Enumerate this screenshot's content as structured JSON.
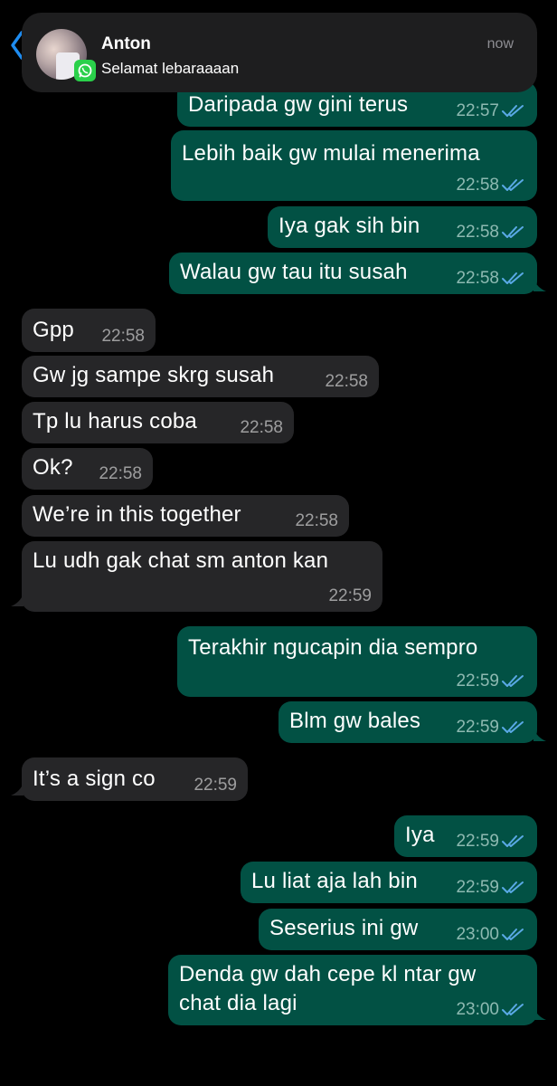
{
  "notification": {
    "sender": "Anton",
    "preview": "Selamat lebaraaaan",
    "time": "now"
  },
  "messages": [
    {
      "text": "Daripada gw gini terus",
      "time": "22:57"
    },
    {
      "text": "Lebih baik gw mulai menerima",
      "time": "22:58"
    },
    {
      "text": "Iya gak sih bin",
      "time": "22:58"
    },
    {
      "text": "Walau gw tau itu susah",
      "time": "22:58"
    },
    {
      "text": "Gpp",
      "time": "22:58"
    },
    {
      "text": "Gw jg sampe skrg susah",
      "time": "22:58"
    },
    {
      "text": "Tp lu harus coba",
      "time": "22:58"
    },
    {
      "text": "Ok?",
      "time": "22:58"
    },
    {
      "text": "We’re in this together",
      "time": "22:58"
    },
    {
      "text": "Lu udh gak chat sm anton kan",
      "time": "22:59"
    },
    {
      "text": "Terakhir ngucapin dia sempro",
      "time": "22:59"
    },
    {
      "text": "Blm gw bales",
      "time": "22:59"
    },
    {
      "text": "It’s a sign co",
      "time": "22:59"
    },
    {
      "text": "Iya",
      "time": "22:59"
    },
    {
      "text": "Lu liat aja lah bin",
      "time": "22:59"
    },
    {
      "text": "Seserius ini gw",
      "time": "23:00"
    },
    {
      "text": "Denda gw dah cepe kl ntar gw",
      "text2": "chat dia lagi",
      "time": "23:00"
    }
  ],
  "colors": {
    "outgoing_bubble": "#025144",
    "incoming_bubble": "#262628",
    "read_ticks": "#5aa9e6",
    "background": "#000000"
  }
}
